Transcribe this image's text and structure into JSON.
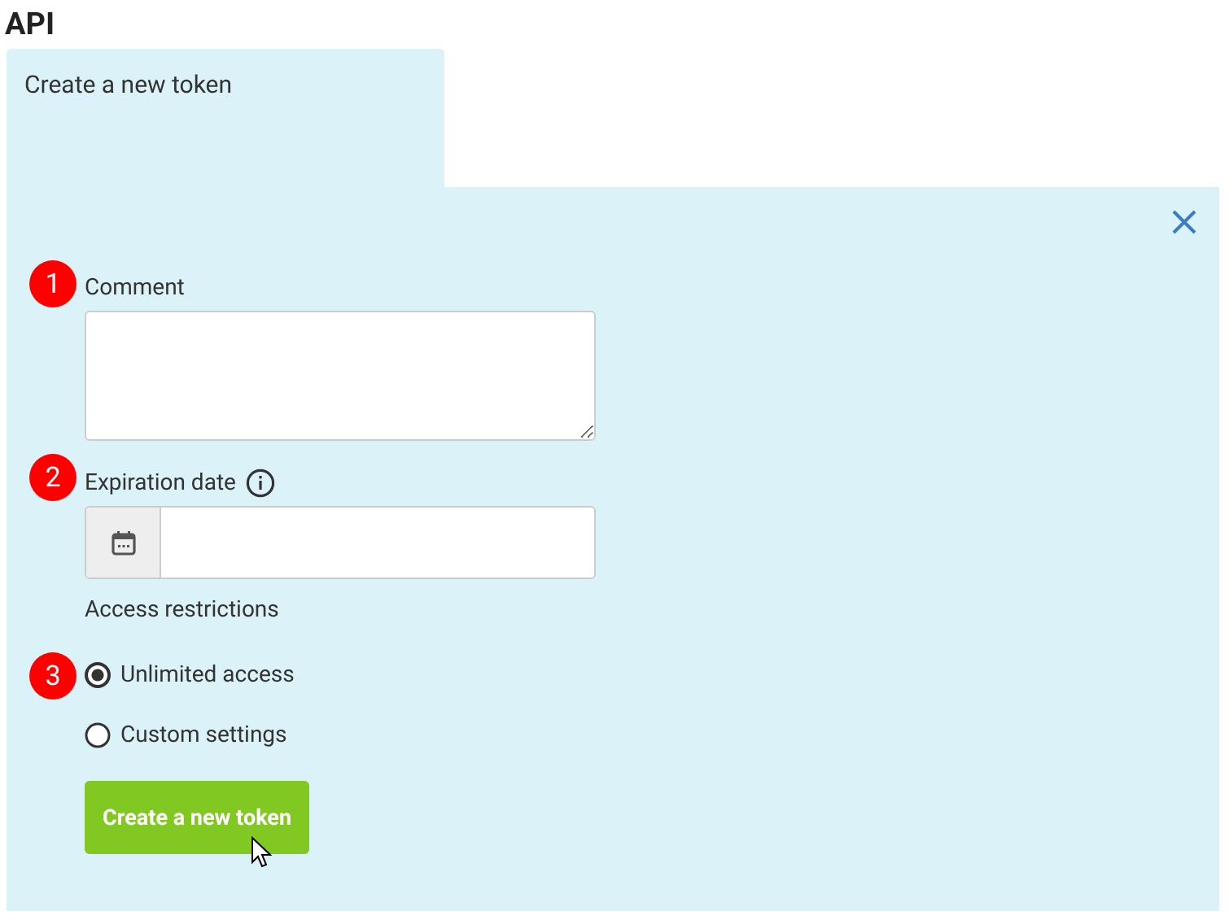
{
  "heading": "API",
  "tab": {
    "label": "Create a new token",
    "selected": true
  },
  "comment": {
    "step": "1",
    "label": "Comment"
  },
  "expiration": {
    "step": "2",
    "label": "Expiration date"
  },
  "access": {
    "label": "Access restrictions",
    "step": "3",
    "options": [
      {
        "label": "Unlimited access",
        "selected": true
      },
      {
        "label": "Custom settings",
        "selected": false
      }
    ]
  },
  "submit": {
    "label": "Create a new token"
  }
}
